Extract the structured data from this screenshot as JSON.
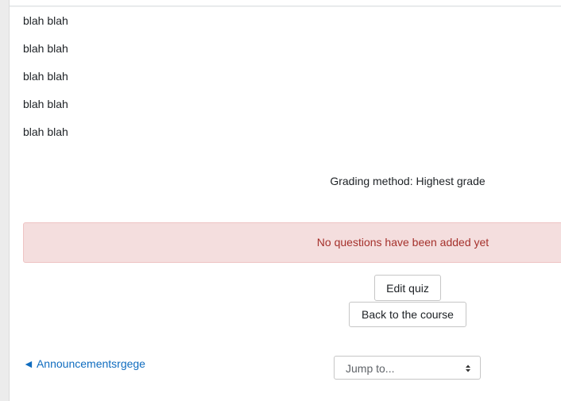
{
  "content": {
    "lines": [
      "blah blah",
      "blah blah",
      "blah blah",
      "blah blah",
      "blah blah"
    ],
    "grading_method": "Grading method: Highest grade"
  },
  "alert": {
    "message": "No questions have been added yet"
  },
  "actions": {
    "edit_quiz_label": "Edit quiz",
    "back_to_course_label": "Back to the course"
  },
  "navigation": {
    "previous_activity_label": "◄ Announcementsrgege",
    "jump_to_placeholder": "Jump to..."
  },
  "icons": {
    "select": "chevron-updown-icon"
  },
  "colors": {
    "link": "#0f6cbf",
    "alert_background": "#f4dede",
    "alert_text": "#a5312c"
  }
}
